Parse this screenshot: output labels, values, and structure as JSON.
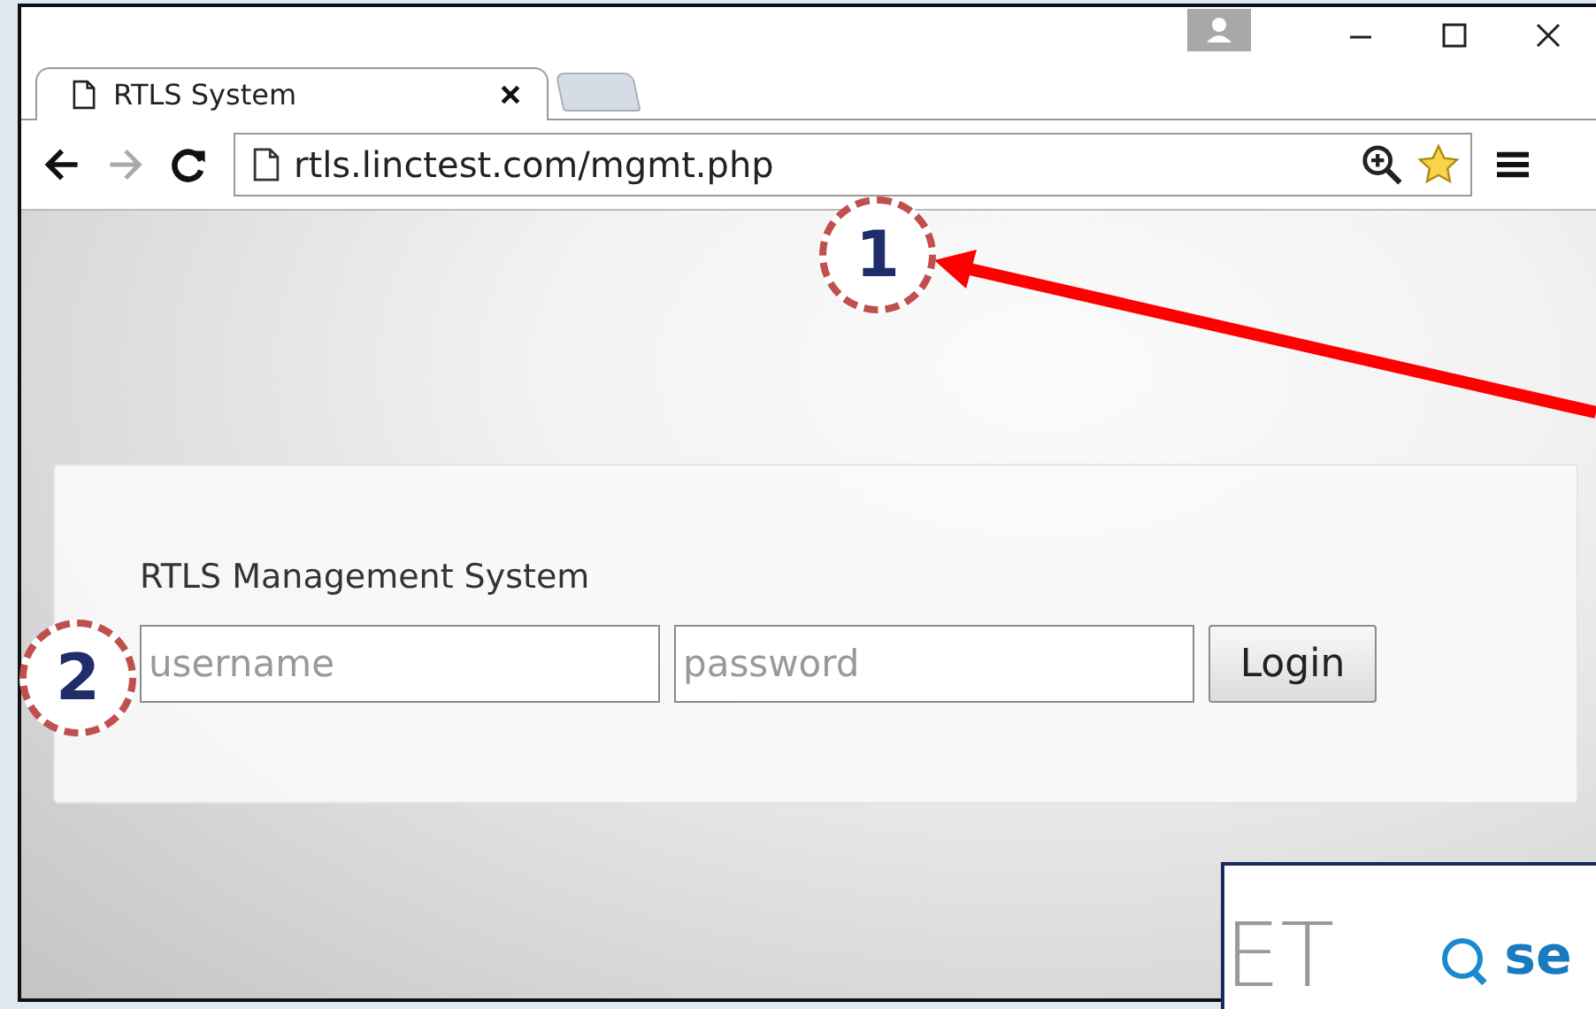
{
  "browser": {
    "tabs": [
      {
        "title": "RTLS System",
        "selected": true
      },
      {
        "selected": false
      }
    ],
    "address": "rtls.linctest.com/mgmt.php"
  },
  "login": {
    "title": "RTLS Management System",
    "username_placeholder": "username",
    "password_placeholder": "password",
    "button": "Login"
  },
  "callouts": [
    {
      "label": "1"
    },
    {
      "label": "2"
    }
  ],
  "overlay": {
    "logo_text": "ET",
    "search_text": "se"
  }
}
